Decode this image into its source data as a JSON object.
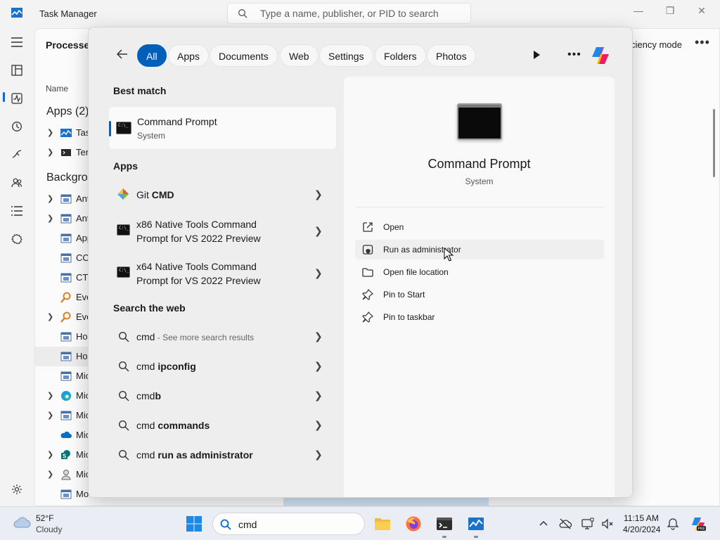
{
  "task_manager": {
    "title": "Task Manager",
    "search_placeholder": "Type a name, publisher, or PID to search",
    "page_title": "Processes",
    "efficiency_partial": "ciency mode",
    "column_name": "Name",
    "apps_section": "Apps (2)",
    "background_section": "Backgrou",
    "app_rows": [
      "Tas",
      "Ter"
    ],
    "background_rows": [
      "Ant",
      "Ant",
      "App",
      "CO",
      "CTI",
      "Eve",
      "Eve",
      "Ho",
      "Ho",
      "Mic",
      "Mic",
      "Mic",
      "Mic",
      "Mic",
      "Mic",
      "Mo"
    ]
  },
  "search_flyout": {
    "tabs": [
      "All",
      "Apps",
      "Documents",
      "Web",
      "Settings",
      "Folders",
      "Photos"
    ],
    "active_tab": "All",
    "best_match_heading": "Best match",
    "best_match": {
      "name": "Command Prompt",
      "type": "System"
    },
    "apps_heading": "Apps",
    "apps": [
      {
        "prefix": "Git ",
        "bold": "CMD"
      },
      {
        "line1": "x86 Native Tools Command",
        "line2": "Prompt for VS 2022 Preview"
      },
      {
        "line1": "x64 Native Tools Command",
        "line2": "Prompt for VS 2022 Preview"
      }
    ],
    "web_heading": "Search the web",
    "web_results": [
      {
        "prefix": "cmd",
        "bold": "",
        "suffix": " - See more search results"
      },
      {
        "prefix": "cmd ",
        "bold": "ipconfig",
        "suffix": ""
      },
      {
        "prefix": "cmd",
        "bold": "b",
        "suffix": ""
      },
      {
        "prefix": "cmd ",
        "bold": "commands",
        "suffix": ""
      },
      {
        "prefix": "cmd ",
        "bold": "run as administrator",
        "suffix": ""
      }
    ],
    "detail": {
      "name": "Command Prompt",
      "type": "System",
      "actions": [
        "Open",
        "Run as administrator",
        "Open file location",
        "Pin to Start",
        "Pin to taskbar"
      ]
    }
  },
  "taskbar": {
    "weather_temp": "52°F",
    "weather_cond": "Cloudy",
    "search_value": "cmd",
    "time": "11:15 AM",
    "date": "4/20/2024"
  },
  "colors": {
    "accent": "#005fb8",
    "task_manager_blue": "#1067c8"
  }
}
